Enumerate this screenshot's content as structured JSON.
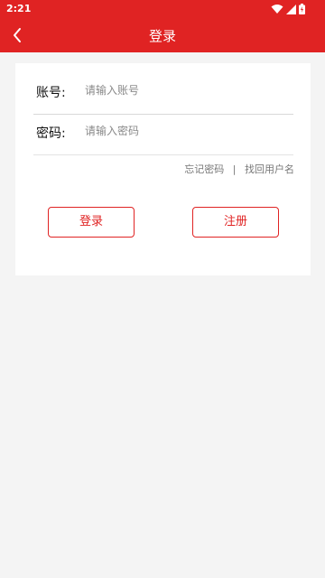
{
  "status_bar": {
    "time": "2:21",
    "icons": [
      "wifi-icon",
      "signal-icon",
      "battery-icon"
    ]
  },
  "header": {
    "title": "登录",
    "back_icon": "chevron-left-icon",
    "background": "#e02323"
  },
  "form": {
    "account": {
      "label": "账号:",
      "placeholder": "请输入账号",
      "value": ""
    },
    "password": {
      "label": "密码:",
      "placeholder": "请输入密码",
      "value": ""
    }
  },
  "links": {
    "forgot_password": "忘记密码",
    "separator": "|",
    "find_username": "找回用户名"
  },
  "buttons": {
    "login": "登录",
    "register": "注册"
  },
  "colors": {
    "accent": "#e02323",
    "page_background": "#f4f4f4"
  }
}
